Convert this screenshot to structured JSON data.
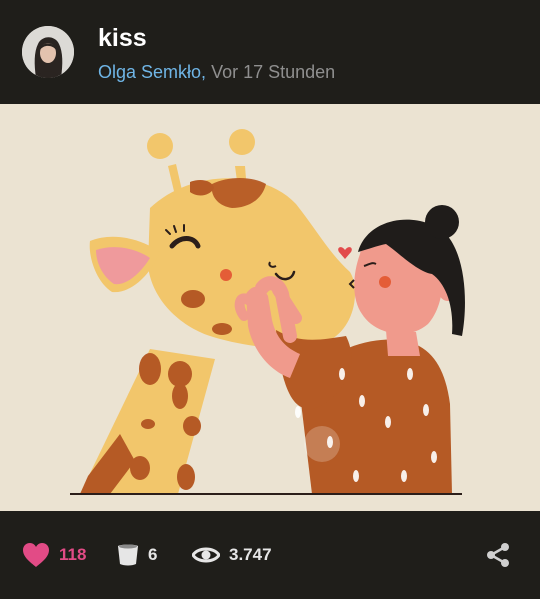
{
  "post": {
    "title": "kiss",
    "author": "Olga Semkło,",
    "time": "Vor 17 Stunden"
  },
  "artwork": {
    "subject": "girl kissing giraffe illustration",
    "colors": {
      "background": "#ebe3d2",
      "giraffe_body": "#f2c66b",
      "giraffe_spots": "#b55a25",
      "skin": "#f09a8c",
      "hair": "#1f1c1a",
      "shirt": "#b55a25"
    }
  },
  "stats": {
    "likes": "118",
    "reblogs": "6",
    "views": "3.747"
  },
  "icons": {
    "like": "heart-icon",
    "reblog": "cup-icon",
    "views": "eye-icon",
    "share": "share-icon"
  },
  "colors": {
    "bar": "#1f1e1a",
    "link": "#6fb5e6",
    "like": "#e24b86"
  }
}
